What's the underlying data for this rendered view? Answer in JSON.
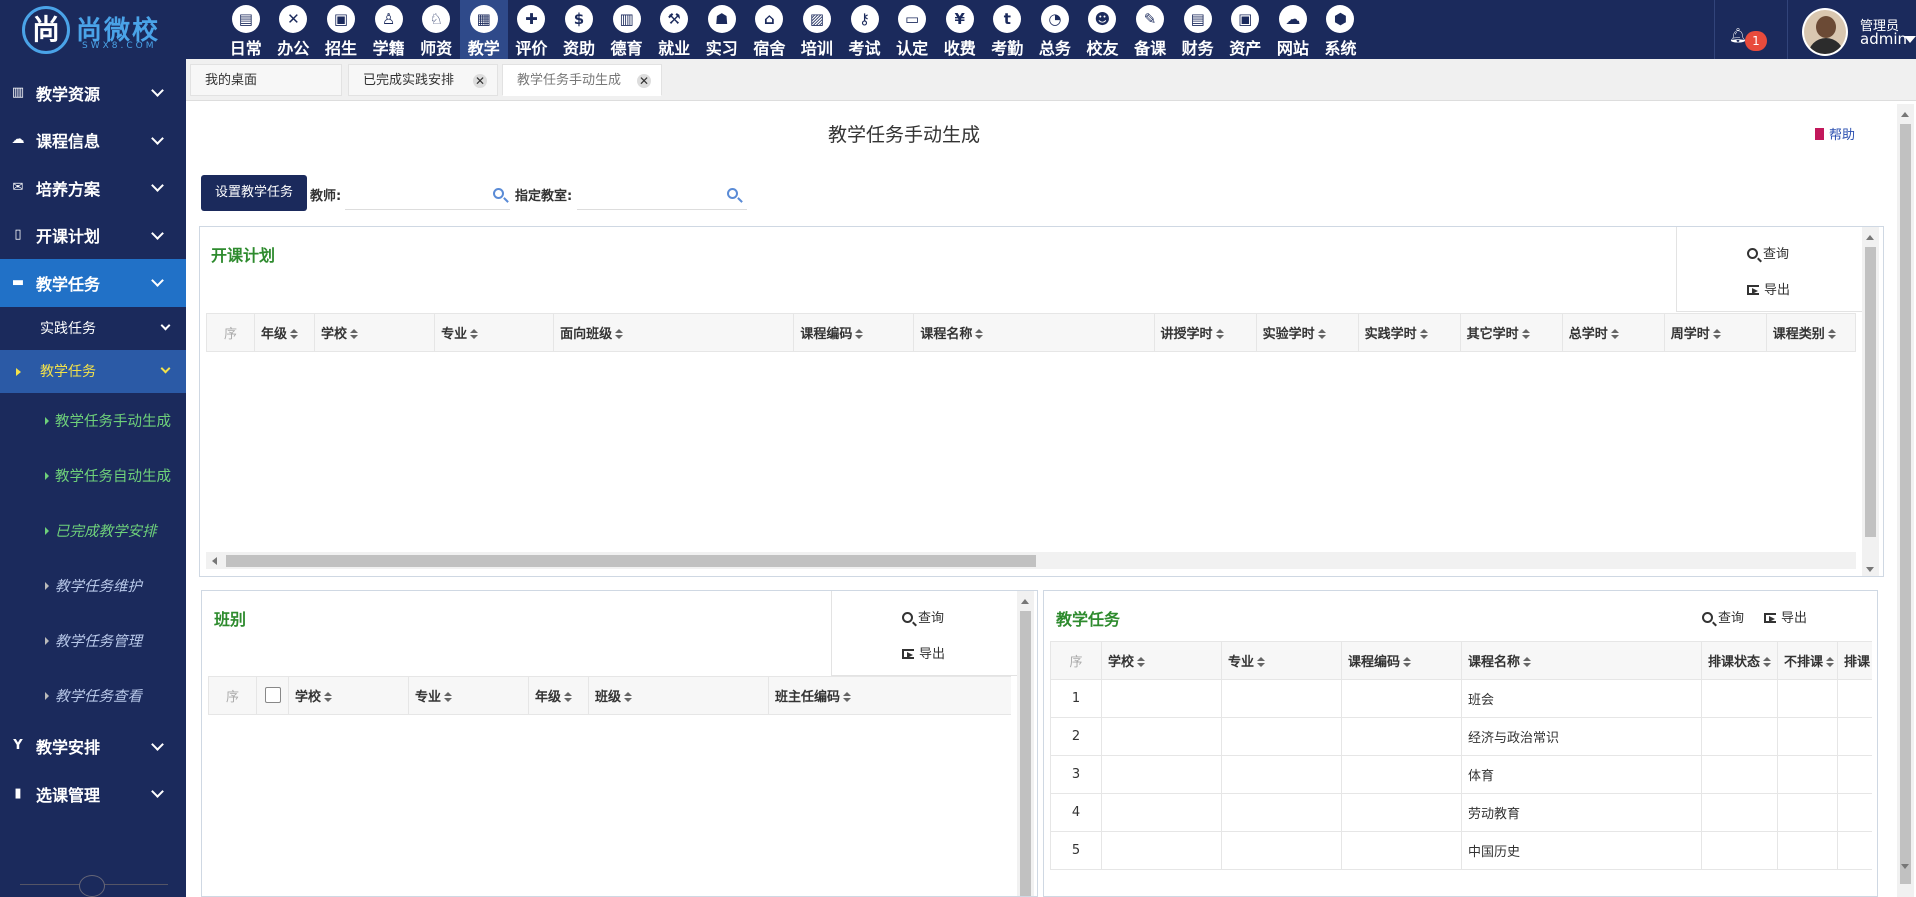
{
  "brand": {
    "name": "尚微校",
    "sub": "SWX8.COM"
  },
  "nav": [
    {
      "label": "日常",
      "icon": "calendar-doc-icon",
      "glyph": "▤"
    },
    {
      "label": "办公",
      "icon": "office-icon",
      "glyph": "✕"
    },
    {
      "label": "招生",
      "icon": "bus-icon",
      "glyph": "▣"
    },
    {
      "label": "学籍",
      "icon": "student-icon",
      "glyph": "♙"
    },
    {
      "label": "师资",
      "icon": "teacher-icon",
      "glyph": "♘"
    },
    {
      "label": "教学",
      "icon": "calendar-grid-icon",
      "glyph": "▦",
      "active": true
    },
    {
      "label": "评价",
      "icon": "calendar-plus-icon",
      "glyph": "✚"
    },
    {
      "label": "资助",
      "icon": "money-bag-icon",
      "glyph": "$"
    },
    {
      "label": "德育",
      "icon": "book-icon",
      "glyph": "▥"
    },
    {
      "label": "就业",
      "icon": "gavel-icon",
      "glyph": "⚒"
    },
    {
      "label": "实习",
      "icon": "robot-icon",
      "glyph": "☗"
    },
    {
      "label": "宿舍",
      "icon": "house-icon",
      "glyph": "⌂"
    },
    {
      "label": "培训",
      "icon": "image-icon",
      "glyph": "▨"
    },
    {
      "label": "考试",
      "icon": "key-icon",
      "glyph": "⚷"
    },
    {
      "label": "认定",
      "icon": "monitor-icon",
      "glyph": "▭"
    },
    {
      "label": "收费",
      "icon": "yen-icon",
      "glyph": "¥"
    },
    {
      "label": "考勤",
      "icon": "t-badge-icon",
      "glyph": "t"
    },
    {
      "label": "总务",
      "icon": "gauge-icon",
      "glyph": "◔"
    },
    {
      "label": "校友",
      "icon": "users-icon",
      "glyph": "☻"
    },
    {
      "label": "备课",
      "icon": "edit-icon",
      "glyph": "✎"
    },
    {
      "label": "财务",
      "icon": "newspaper-icon",
      "glyph": "▤"
    },
    {
      "label": "资产",
      "icon": "train-icon",
      "glyph": "▣"
    },
    {
      "label": "网站",
      "icon": "cloud-icon",
      "glyph": "☁"
    },
    {
      "label": "系统",
      "icon": "cube-icon",
      "glyph": "⬢"
    }
  ],
  "user": {
    "notifications": "1",
    "role": "管理员",
    "name": "admin"
  },
  "sidebar": {
    "groups_top": [
      {
        "label": "教学资源",
        "icon": "book-icon",
        "glyph": "▥"
      },
      {
        "label": "课程信息",
        "icon": "cloud-icon",
        "glyph": "☁"
      },
      {
        "label": "培养方案",
        "icon": "envelope-icon",
        "glyph": "✉"
      },
      {
        "label": "开课计划",
        "icon": "file-icon",
        "glyph": "▯"
      },
      {
        "label": "教学任务",
        "icon": "folder-icon",
        "glyph": "▬",
        "active": true
      }
    ],
    "sub1": [
      {
        "label": "实践任务"
      },
      {
        "label": "教学任务",
        "active": true
      }
    ],
    "sub2": [
      {
        "label": "教学任务手动生成",
        "style": "green"
      },
      {
        "label": "教学任务自动生成",
        "style": "green"
      },
      {
        "label": "已完成教学安排",
        "style": "green-ital"
      },
      {
        "label": "教学任务维护",
        "style": "ital"
      },
      {
        "label": "教学任务管理",
        "style": "ital"
      },
      {
        "label": "教学任务查看",
        "style": "ital"
      }
    ],
    "groups_bottom": [
      {
        "label": "教学安排",
        "icon": "y-badge-icon",
        "glyph": "Y"
      },
      {
        "label": "选课管理",
        "icon": "columns-icon",
        "glyph": "▮"
      }
    ]
  },
  "tabs": [
    {
      "label": "我的桌面"
    },
    {
      "label": "已完成实践安排",
      "close": "✕"
    },
    {
      "label": "教学任务手动生成",
      "close": "✕",
      "active": true
    }
  ],
  "page": {
    "title": "教学任务手动生成",
    "help": "帮助",
    "set_button": "设置教学任务",
    "teacher_label": "教师:",
    "room_label": "指定教室:"
  },
  "plan_panel": {
    "title": "开课计划",
    "query": "查询",
    "export": "导出",
    "columns": [
      "序",
      "年级",
      "学校",
      "专业",
      "面向班级",
      "课程编码",
      "课程名称",
      "讲授学时",
      "实验学时",
      "实践学时",
      "其它学时",
      "总学时",
      "周学时",
      "课程类别"
    ]
  },
  "class_panel": {
    "title": "班别",
    "query": "查询",
    "export": "导出",
    "columns": [
      "序",
      "",
      "学校",
      "专业",
      "年级",
      "班级",
      "班主任编码"
    ]
  },
  "task_panel": {
    "title": "教学任务",
    "query": "查询",
    "export": "导出",
    "columns": [
      "序",
      "学校",
      "专业",
      "课程编码",
      "课程名称",
      "排课状态",
      "不排课",
      "排课"
    ],
    "rows": [
      {
        "seq": "1",
        "course": "班会"
      },
      {
        "seq": "2",
        "course": "经济与政治常识"
      },
      {
        "seq": "3",
        "course": "体育"
      },
      {
        "seq": "4",
        "course": "劳动教育"
      },
      {
        "seq": "5",
        "course": "中国历史"
      }
    ]
  }
}
